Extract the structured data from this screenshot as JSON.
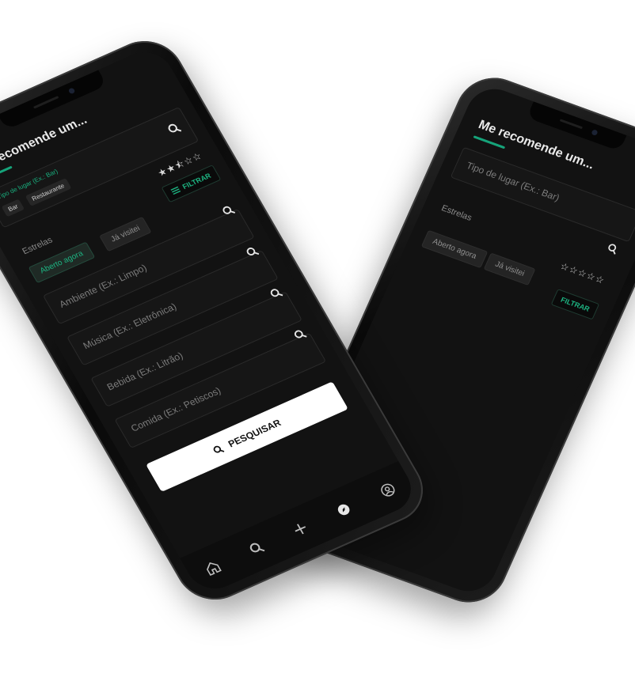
{
  "front": {
    "title": "Me recomende um...",
    "place_field": {
      "label": "Tipo de lugar (Ex.: Bar)",
      "chips": [
        "Bar",
        "Restaurante"
      ]
    },
    "stars_label": "Estrelas",
    "stars": "★★⯪☆☆",
    "rating": 2.5,
    "pills": {
      "open": "Aberto agora",
      "visited": "Já visitei"
    },
    "filter_label": "FILTRAR",
    "fields": [
      {
        "placeholder": "Ambiente (Ex.: Limpo)"
      },
      {
        "placeholder": "Música (Ex.: Eletrônica)"
      },
      {
        "placeholder": "Bebida (Ex.: Litrão)"
      },
      {
        "placeholder": "Comida (Ex.: Petiscos)"
      }
    ],
    "search_label": "PESQUISAR",
    "tabs": [
      "home-icon",
      "search-icon",
      "plus-icon",
      "compass-icon",
      "profile-icon"
    ]
  },
  "back": {
    "title": "Me recomende um...",
    "place_placeholder": "Tipo de lugar (Ex.: Bar)",
    "stars_label": "Estrelas",
    "stars": "☆☆☆☆☆",
    "rating": 0,
    "pills": {
      "open": "Aberto agora",
      "visited": "Já visitei"
    },
    "filter_label": "FILTRAR"
  },
  "colors": {
    "accent": "#1db482",
    "background": "#121212",
    "button": "#ffffff"
  }
}
